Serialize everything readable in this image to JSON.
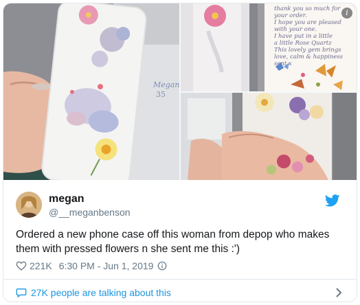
{
  "tweet": {
    "author_name": "megan",
    "author_handle": "@__meganbenson",
    "text": "Ordered a new phone case off this woman from depop who makes them with pressed flowers n she sent me this :')",
    "likes": "221K",
    "timestamp": "6:30 PM - Jun 1, 2019",
    "conversation": "27K people are talking about this"
  },
  "media": {
    "note_lines": [
      "thank you so much for",
      "your order.",
      "I hope you are pleased",
      "with your one.",
      "I have put in a little",
      "a little Rose Quartz",
      "This lovely gem brings",
      "love, calm & happiness",
      "sent x"
    ],
    "envelope_text": [
      "Megan",
      "35"
    ]
  },
  "colors": {
    "accent": "#1da1f2",
    "link": "#1b95e0",
    "muted": "#657786",
    "border": "#e1e8ed"
  },
  "icons": {
    "brand": "twitter-bird-icon",
    "like": "heart-icon",
    "info": "info-icon",
    "reply": "speech-bubble-icon",
    "more": "chevron-right-icon"
  }
}
